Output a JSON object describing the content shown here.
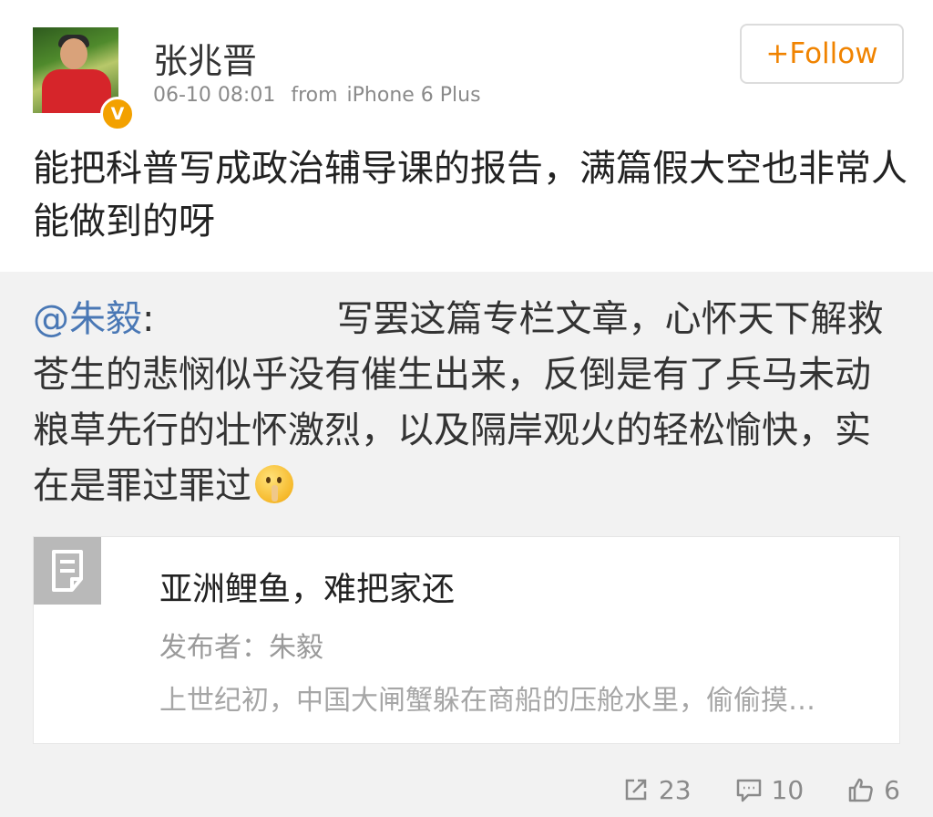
{
  "user": {
    "name": "张兆晋",
    "time": "06-10 08:01",
    "from_label": "from",
    "device": "iPhone 6 Plus",
    "verified_mark": "V",
    "follow_label": "+Follow"
  },
  "post": {
    "text": "能把科普写成政治辅导课的报告，满篇假大空也非常人能做到的呀"
  },
  "repost": {
    "mention": "@朱毅",
    "colon": ":",
    "text": "写罢这篇专栏文章，心怀天下解救苍生的悲悯似乎没有催生出来，反倒是有了兵马未动粮草先行的壮怀激烈，以及隔岸观火的轻松愉快，实在是罪过罪过",
    "emoji_icon": "shush-emoji-icon",
    "card": {
      "title": "亚洲鲤鱼，难把家还",
      "author": "发布者：朱毅",
      "summary": "上世纪初，中国大闸蟹躲在商船的压舱水里，偷偷摸…",
      "thumb_icon": "article-icon"
    }
  },
  "actions": {
    "repost_count": "23",
    "comment_count": "10",
    "like_count": "6"
  },
  "colors": {
    "accent": "#f08300",
    "mention": "#4a78b5",
    "verified": "#f3a100",
    "repost_bg": "#f2f2f2"
  }
}
